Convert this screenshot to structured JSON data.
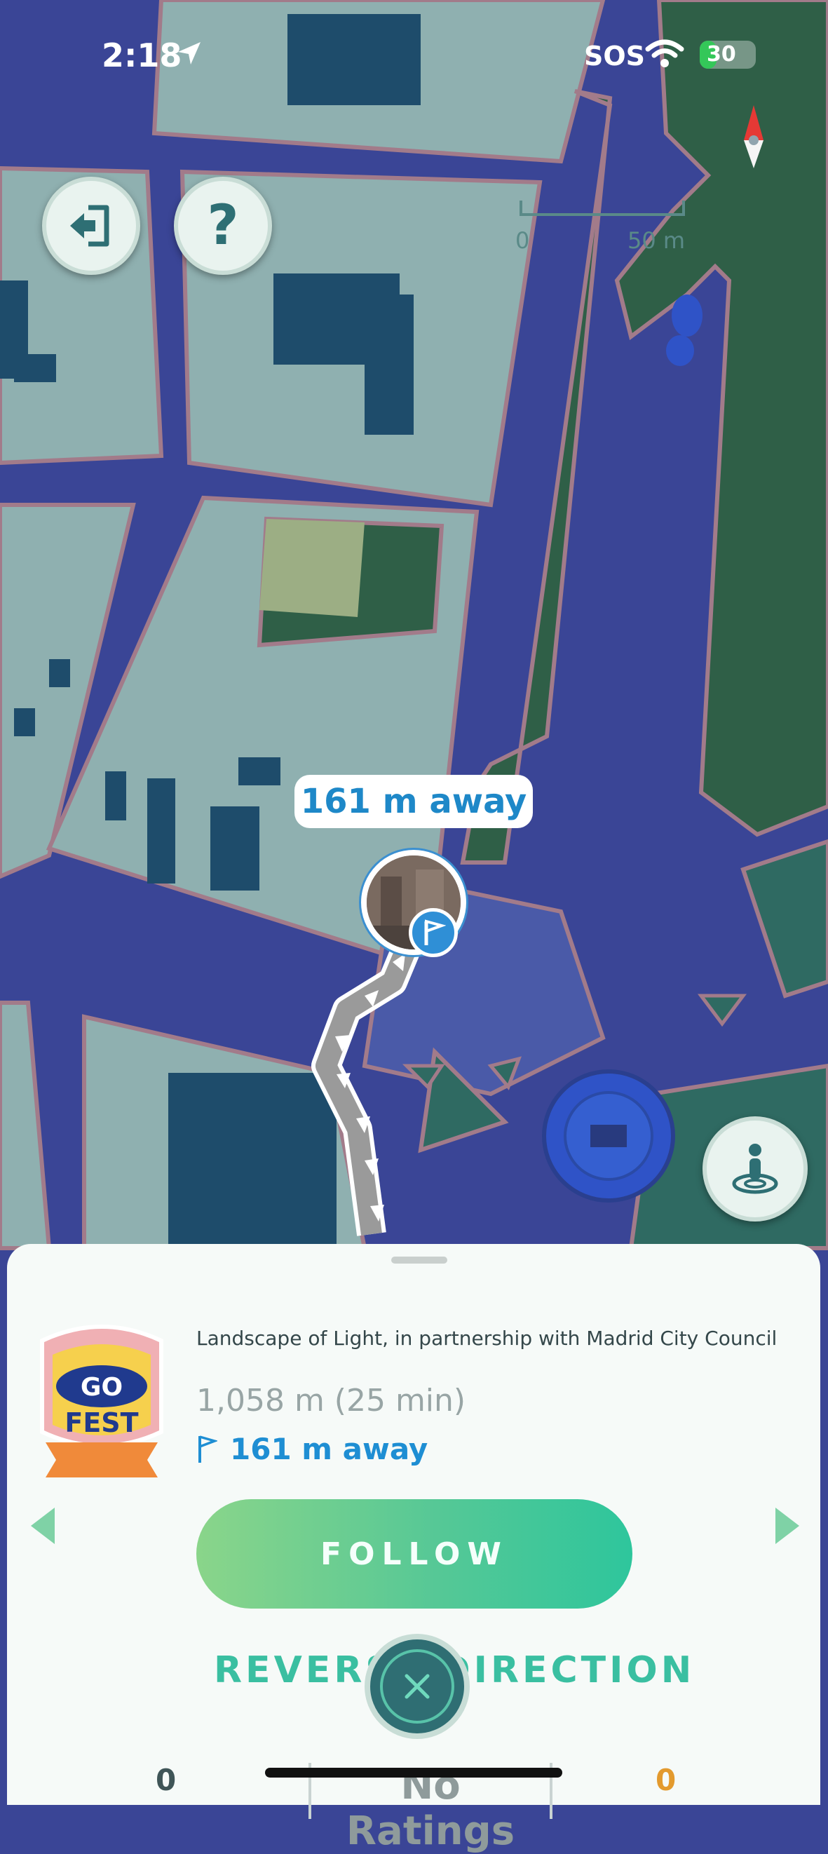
{
  "status_bar": {
    "time": "2:18",
    "sos": "SOS",
    "battery": "30",
    "battery_level": 0.3
  },
  "map": {
    "scale_start": "0",
    "scale_end": "50 m",
    "bubble_distance": "161 m away"
  },
  "buttons": {
    "exit_icon": "exit-door-icon",
    "help_label": "?",
    "avatar_icon": "person-ring-icon"
  },
  "sheet": {
    "title": "Landscape of Light, in partnership with Madrid City Council",
    "route_info": "1,058 m (25 min)",
    "distance": "161 m away",
    "follow_label": "FOLLOW",
    "reverse_label": "REVERSE DIRECTION",
    "stats": {
      "left": "0",
      "middle": "No Ratings",
      "right": "0"
    }
  },
  "colors": {
    "map_road": "#3a4596",
    "accent_green": "#2ec69c",
    "link_blue": "#1e8ed3"
  }
}
